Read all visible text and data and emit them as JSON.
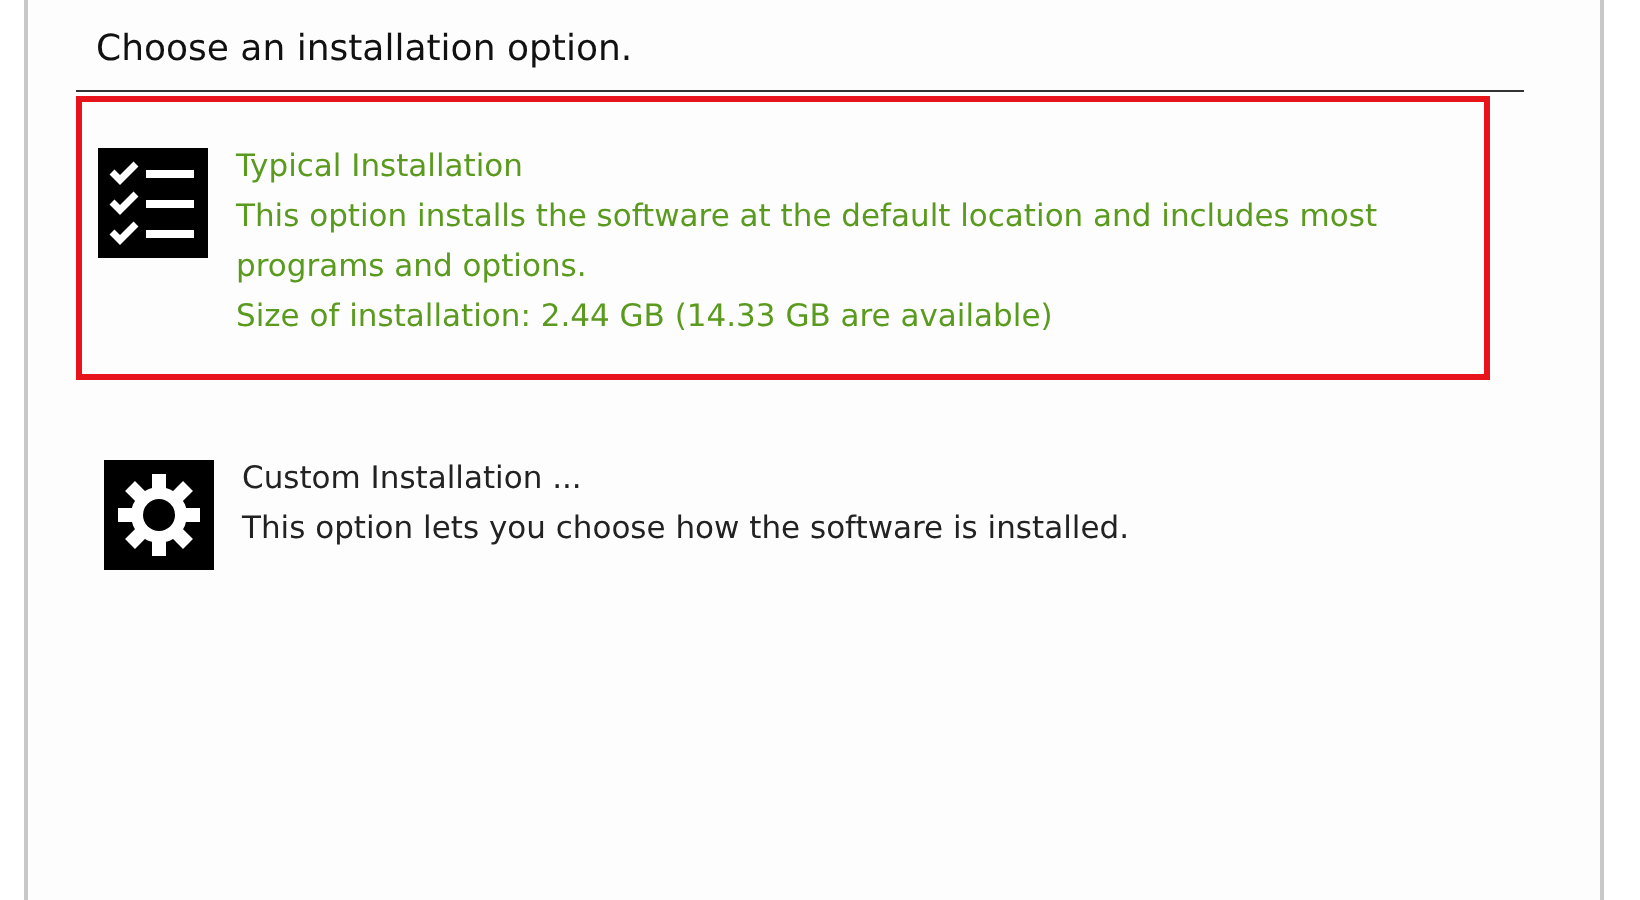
{
  "heading": "Choose an installation option.",
  "options": [
    {
      "kind": "checklist",
      "title": "Typical Installation",
      "description": "This option installs the software at the default location and includes most programs and options.",
      "detail": "Size of installation: 2.44 GB (14.33 GB are available)",
      "selected": true,
      "highlighted": true
    },
    {
      "kind": "gear",
      "title": "Custom Installation ...",
      "description": "This option lets you choose how the software is installed.",
      "selected": false,
      "highlighted": false
    }
  ]
}
